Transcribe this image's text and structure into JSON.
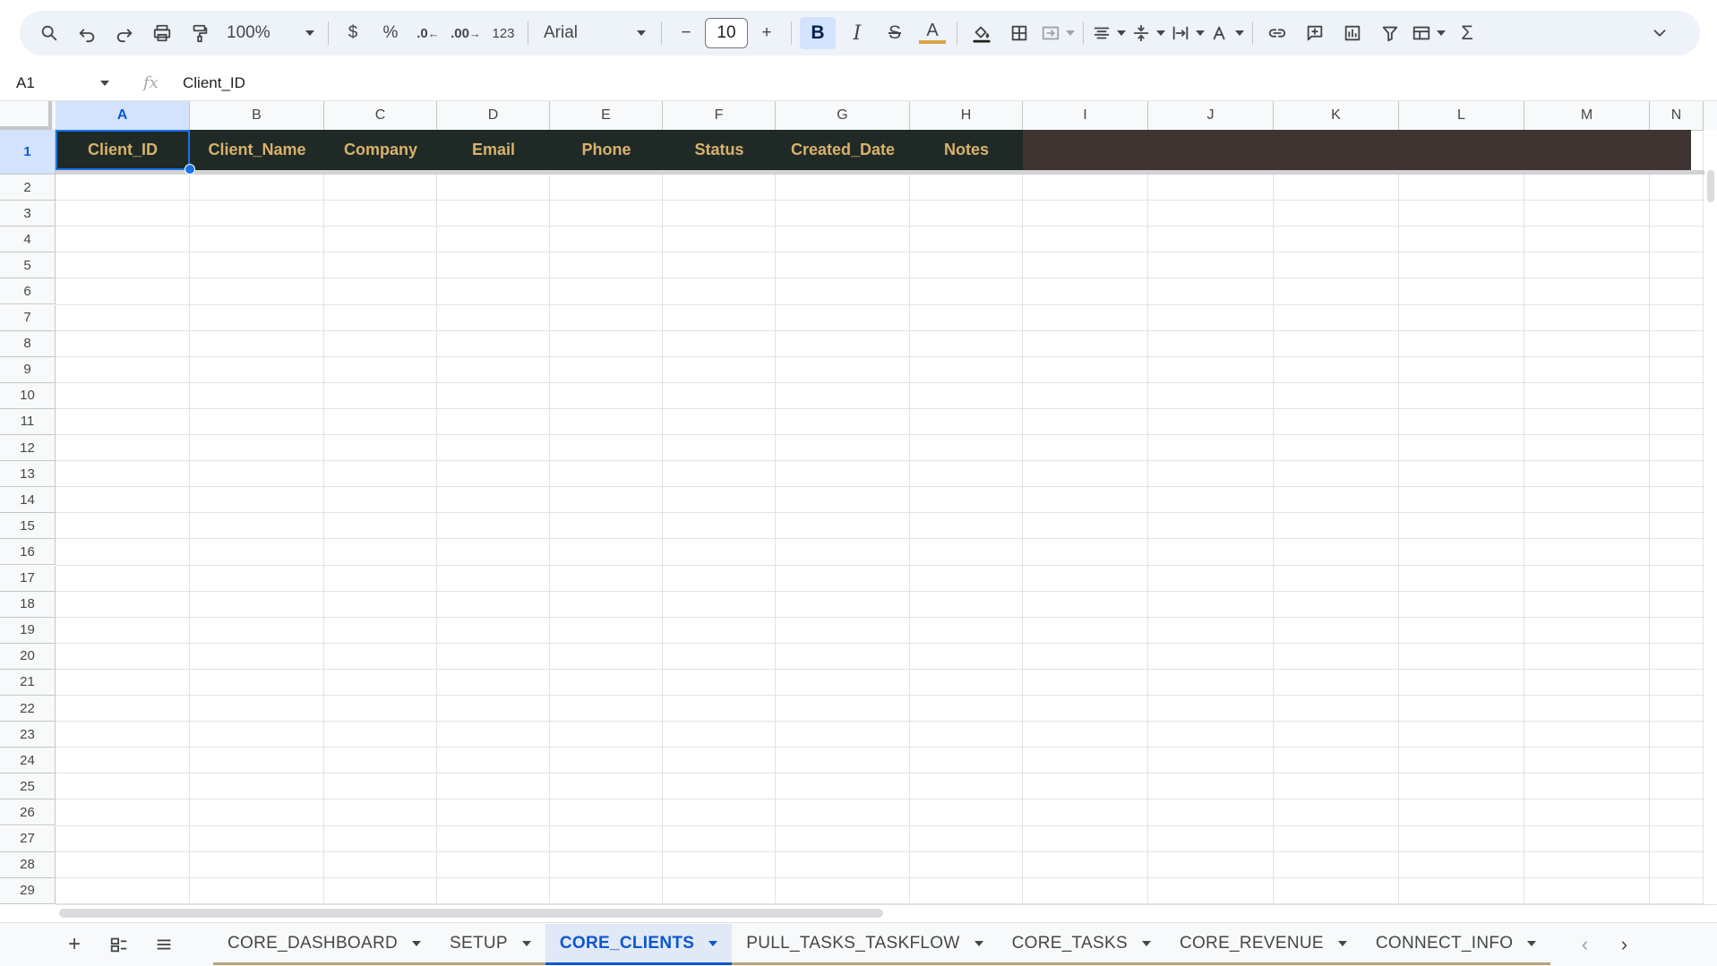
{
  "toolbar": {
    "zoom": "100%",
    "currency": "$",
    "percent": "%",
    "decrease_decimal": ".0",
    "increase_decimal": ".00",
    "number_format": "123",
    "font": "Arial",
    "font_size": "10",
    "bold": "B",
    "italic": "I",
    "strike": "S",
    "text_color_glyph": "A",
    "text_color": "#d9a441",
    "sum": "Σ"
  },
  "formula_bar": {
    "cell_ref": "A1",
    "fx": "fx",
    "value": "Client_ID"
  },
  "grid": {
    "columns": [
      "A",
      "B",
      "C",
      "D",
      "E",
      "F",
      "G",
      "H",
      "I",
      "J",
      "K",
      "L",
      "M",
      "N"
    ],
    "selected_column": "A",
    "rows": [
      "1",
      "2",
      "3",
      "4",
      "5",
      "6",
      "7",
      "8",
      "9",
      "10",
      "11",
      "12",
      "13",
      "14",
      "15",
      "16",
      "17",
      "18",
      "19",
      "20",
      "21",
      "22",
      "23",
      "24",
      "25",
      "26",
      "27",
      "28",
      "29"
    ],
    "header_row": [
      "Client_ID",
      "Client_Name",
      "Company",
      "Email",
      "Phone",
      "Status",
      "Created_Date",
      "Notes"
    ],
    "header_bg": "#1f2a27",
    "header_text_color": "#d9b26a"
  },
  "sheets": {
    "tabs": [
      "CORE_DASHBOARD",
      "SETUP",
      "CORE_CLIENTS",
      "PULL_TASKS_TASKFLOW",
      "CORE_TASKS",
      "CORE_REVENUE",
      "CONNECT_INFO"
    ],
    "active": "CORE_CLIENTS"
  }
}
